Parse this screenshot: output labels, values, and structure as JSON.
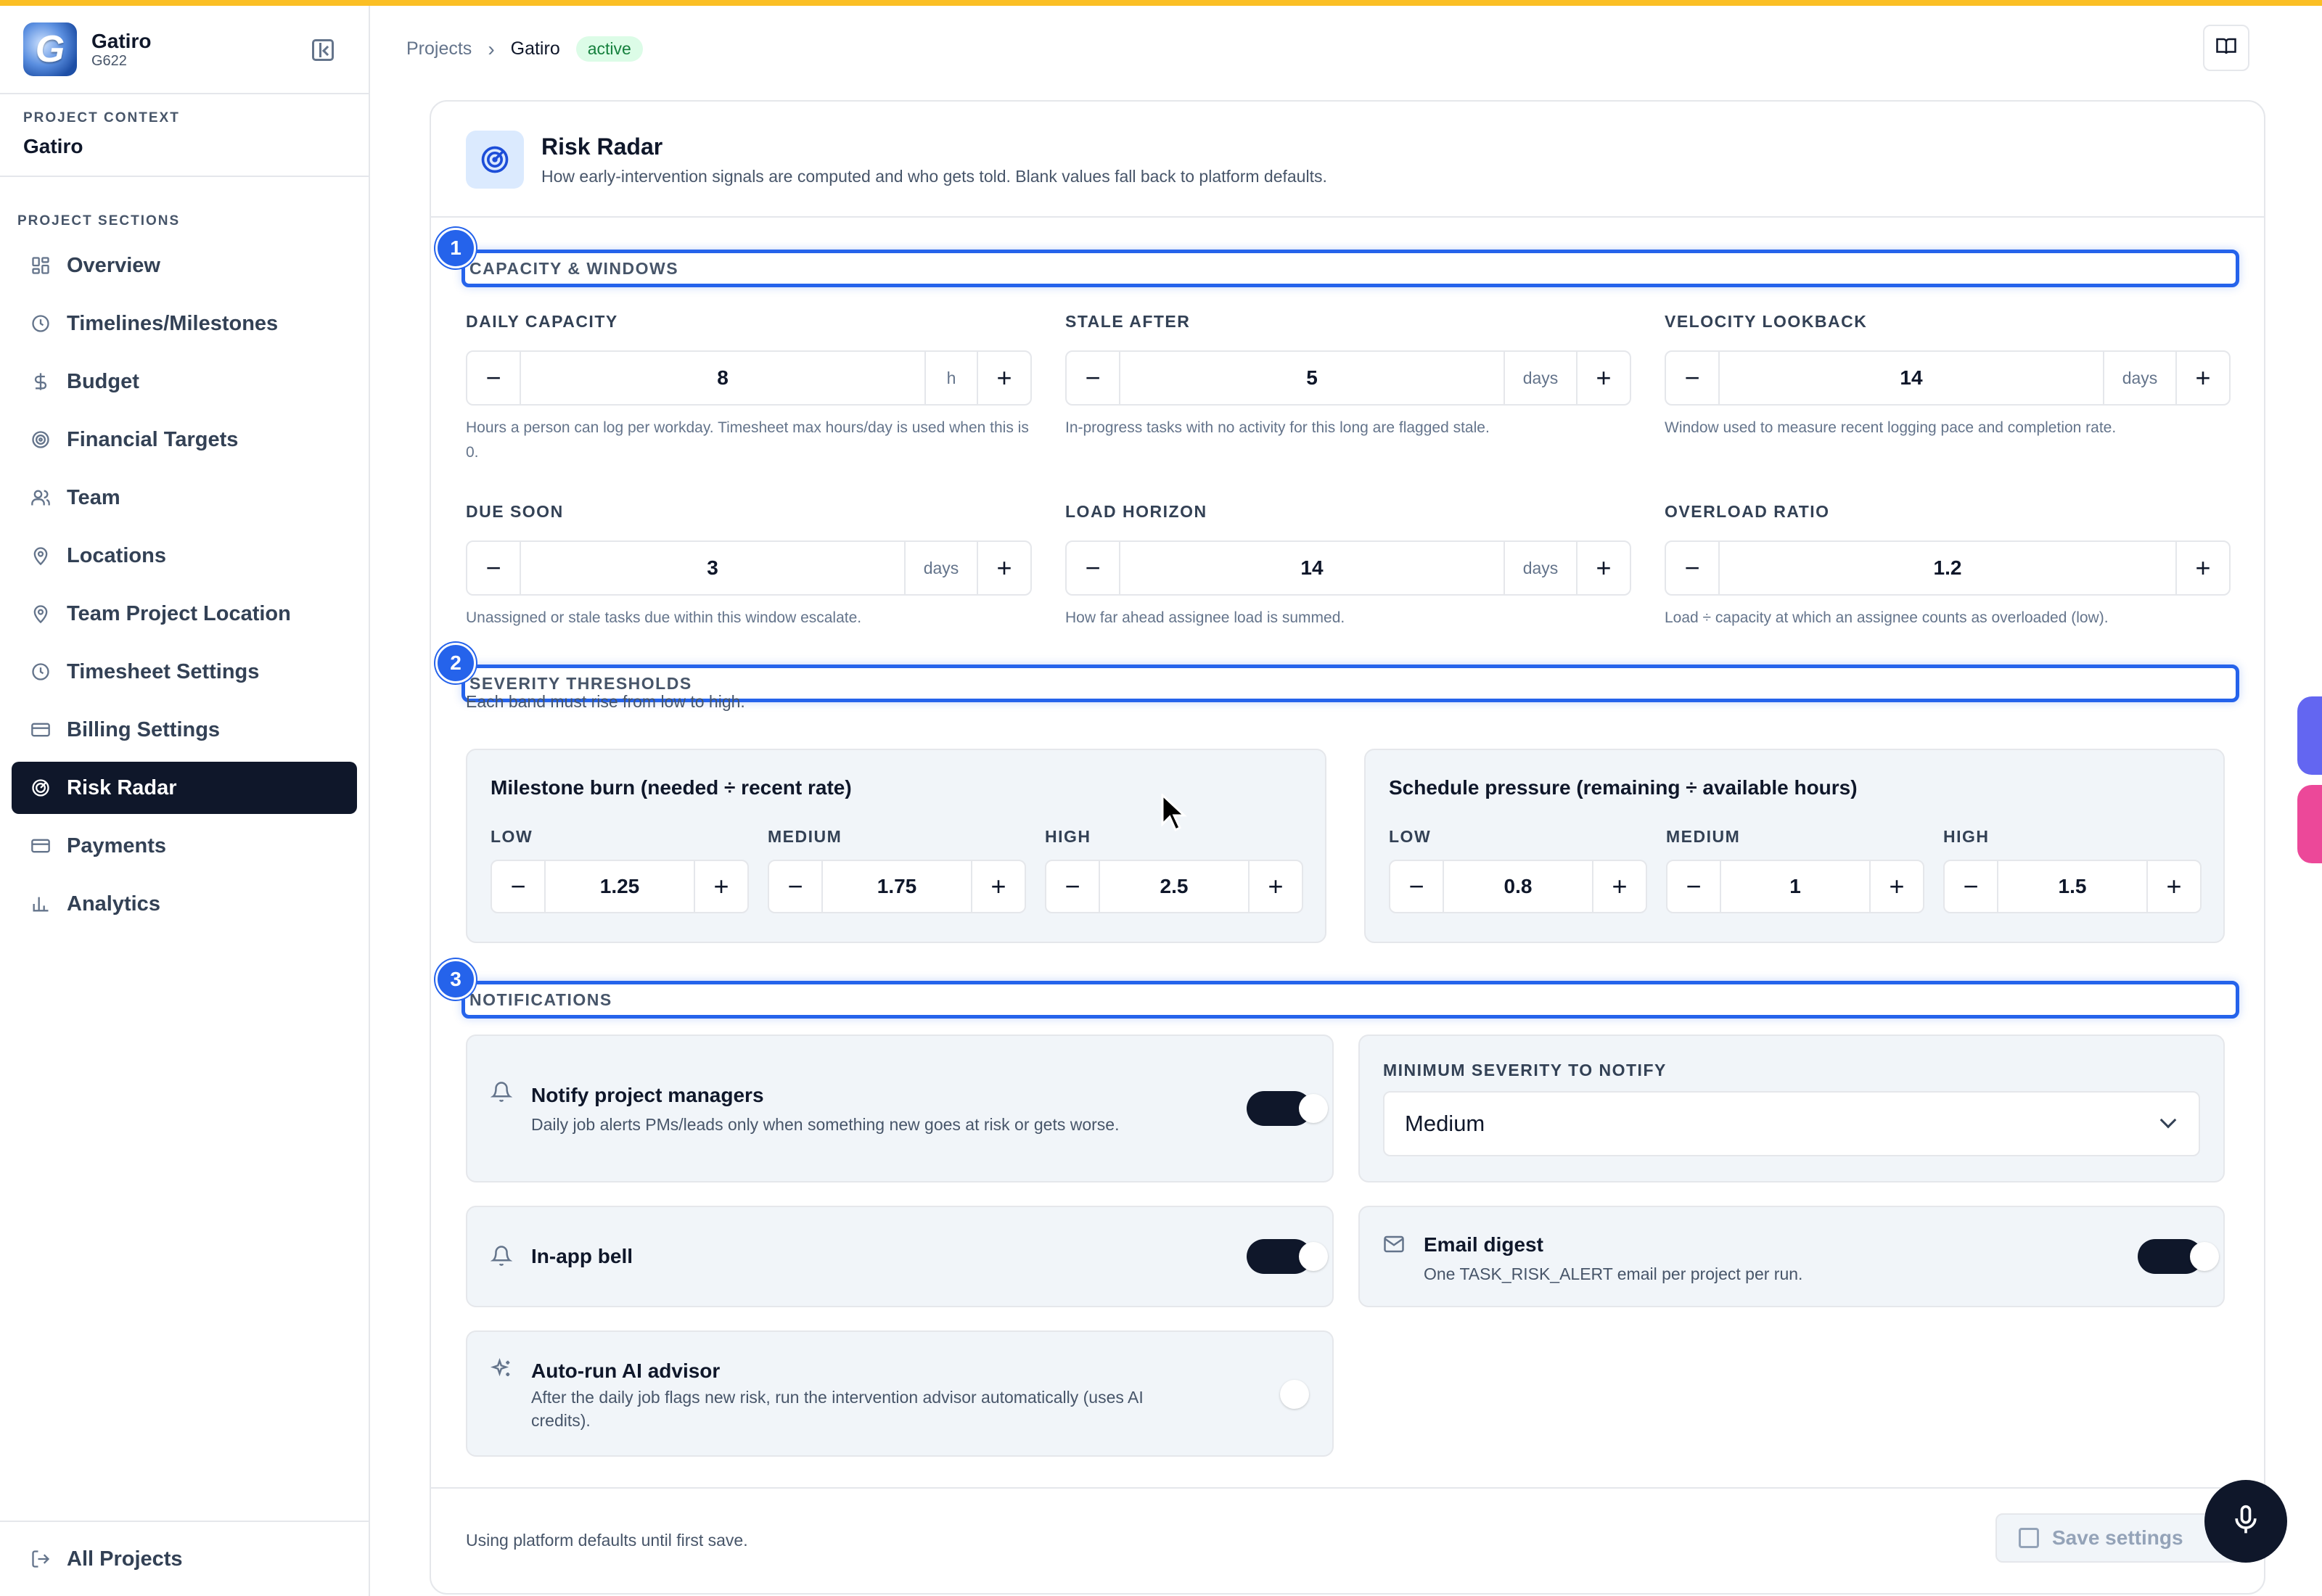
{
  "brand": {
    "name": "Gatiro",
    "code": "G622",
    "logo_letter": "G"
  },
  "context": {
    "caption": "PROJECT CONTEXT",
    "name": "Gatiro"
  },
  "sections_caption": "PROJECT SECTIONS",
  "nav": [
    {
      "label": "Overview",
      "icon": "grid-icon"
    },
    {
      "label": "Timelines/Milestones",
      "icon": "clock-icon"
    },
    {
      "label": "Budget",
      "icon": "dollar-icon"
    },
    {
      "label": "Financial Targets",
      "icon": "target-icon"
    },
    {
      "label": "Team",
      "icon": "users-icon"
    },
    {
      "label": "Locations",
      "icon": "map-pin-icon"
    },
    {
      "label": "Team Project Location",
      "icon": "map-pin-icon"
    },
    {
      "label": "Timesheet Settings",
      "icon": "clock-icon"
    },
    {
      "label": "Billing Settings",
      "icon": "credit-card-icon"
    },
    {
      "label": "Risk Radar",
      "icon": "radar-icon",
      "active": true
    },
    {
      "label": "Payments",
      "icon": "credit-card-icon"
    },
    {
      "label": "Analytics",
      "icon": "bar-chart-icon"
    }
  ],
  "footer": {
    "all_projects": "All Projects"
  },
  "breadcrumb": {
    "root": "Projects",
    "sep": "›",
    "current": "Gatiro",
    "status": "active"
  },
  "page": {
    "title": "Risk Radar",
    "description": "How early-intervention signals are computed and who gets told. Blank values fall back to platform defaults."
  },
  "sections": {
    "capacity": {
      "num": "1",
      "label": "CAPACITY & WINDOWS"
    },
    "severity": {
      "num": "2",
      "label": "SEVERITY THRESHOLDS",
      "subtitle": "Each band must rise from low to high."
    },
    "notifications": {
      "num": "3",
      "label": "NOTIFICATIONS"
    }
  },
  "capacity_fields": {
    "daily_capacity": {
      "label": "DAILY CAPACITY",
      "value": "8",
      "unit": "h",
      "help": "Hours a person can log per workday. Timesheet max hours/day is used when this is 0."
    },
    "stale_after": {
      "label": "STALE AFTER",
      "value": "5",
      "unit": "days",
      "help": "In-progress tasks with no activity for this long are flagged stale."
    },
    "velocity_lookback": {
      "label": "VELOCITY LOOKBACK",
      "value": "14",
      "unit": "days",
      "help": "Window used to measure recent logging pace and completion rate."
    },
    "due_soon": {
      "label": "DUE SOON",
      "value": "3",
      "unit": "days",
      "help": "Unassigned or stale tasks due within this window escalate."
    },
    "load_horizon": {
      "label": "LOAD HORIZON",
      "value": "14",
      "unit": "days",
      "help": "How far ahead assignee load is summed."
    },
    "overload_ratio": {
      "label": "OVERLOAD RATIO",
      "value": "1.2",
      "unit": "",
      "help": "Load ÷ capacity at which an assignee counts as overloaded (low)."
    }
  },
  "stepper_symbols": {
    "minus": "−",
    "plus": "+"
  },
  "milestone_burn": {
    "title": "Milestone burn (needed ÷ recent rate)",
    "low": {
      "label": "LOW",
      "value": "1.25"
    },
    "medium": {
      "label": "MEDIUM",
      "value": "1.75"
    },
    "high": {
      "label": "HIGH",
      "value": "2.5"
    }
  },
  "schedule_pressure": {
    "title": "Schedule pressure (remaining ÷ available hours)",
    "low": {
      "label": "LOW",
      "value": "0.8"
    },
    "medium": {
      "label": "MEDIUM",
      "value": "1"
    },
    "high": {
      "label": "HIGH",
      "value": "1.5"
    }
  },
  "notifications": {
    "notify_pms": {
      "title": "Notify project managers",
      "desc": "Daily job alerts PMs/leads only when something new goes at risk or gets worse.",
      "on": true
    },
    "min_severity": {
      "label": "MINIMUM SEVERITY TO NOTIFY",
      "value": "Medium"
    },
    "in_app_bell": {
      "title": "In-app bell",
      "on": true
    },
    "email_digest": {
      "title": "Email digest",
      "desc": "One TASK_RISK_ALERT email per project per run.",
      "on": true
    },
    "auto_ai": {
      "title": "Auto-run AI advisor",
      "desc": "After the daily job flags new risk, run the intervention advisor automatically (uses AI credits).",
      "on": false
    }
  },
  "card_footer": {
    "note": "Using platform defaults until first save.",
    "save_label": "Save settings"
  },
  "colors": {
    "accent": "#2563eb",
    "dark": "#0f172a",
    "top_accent": "#fbbf24",
    "edge_purple": "#6366f1",
    "edge_pink": "#ec4899"
  }
}
